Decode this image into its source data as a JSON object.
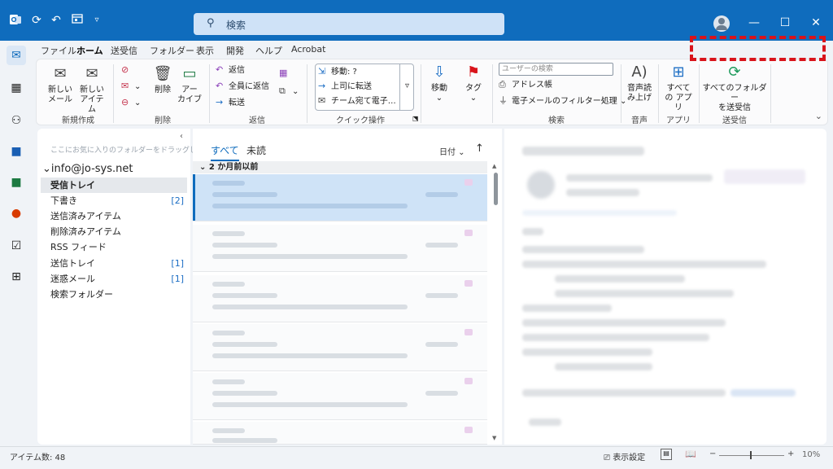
{
  "titlebar": {
    "search_placeholder": "検索",
    "icons": [
      "outlook-logo-icon",
      "sync-icon",
      "undo-icon",
      "calendar-view-icon",
      "customize-caret-icon"
    ]
  },
  "menu": [
    "ファイル",
    "ホーム",
    "送受信",
    "フォルダー",
    "表示",
    "開発",
    "ヘルプ",
    "Acrobat"
  ],
  "ribbon": {
    "new_mail": "新しい\nメール",
    "new_item": "新しい\nアイテム",
    "group_new": "新規作成",
    "delete": "削除",
    "archive": "アー\nカイブ",
    "group_delete": "削除",
    "reply": "返信",
    "reply_all": "全員に返信",
    "forward": "転送",
    "group_reply": "返信",
    "qs_move": "移動: ?",
    "qs_manager": "上司に転送",
    "qs_team": "チーム宛て電子…",
    "group_quick": "クイック操作",
    "move": "移動",
    "tags": "タグ",
    "user_search_placeholder": "ユーザーの検索",
    "address_book": "アドレス帳",
    "filter_mail": "電子メールのフィルター処理",
    "group_search": "検索",
    "read_aloud": "音声読\nみ上げ",
    "group_voice": "音声",
    "all_apps": "すべて\nの アプリ",
    "group_apps": "アプリ",
    "send_receive_all": "すべてのフォルダー\nを送受信",
    "group_send_receive": "送受信"
  },
  "folders": {
    "fav_hint": "ここにお気に入りのフォルダーをドラッグします",
    "account": "info@jo-sys.net",
    "items": [
      {
        "label": "受信トレイ",
        "count": ""
      },
      {
        "label": "下書き",
        "count": "[2]"
      },
      {
        "label": "送信済みアイテム",
        "count": ""
      },
      {
        "label": "削除済みアイテム",
        "count": ""
      },
      {
        "label": "RSS フィード",
        "count": ""
      },
      {
        "label": "送信トレイ",
        "count": "[1]"
      },
      {
        "label": "迷惑メール",
        "count": "[1]"
      },
      {
        "label": "検索フォルダー",
        "count": ""
      }
    ]
  },
  "messages": {
    "tab_all": "すべて",
    "tab_unread": "未読",
    "sort_by": "日付",
    "group_header": "2 か月前以前"
  },
  "status": {
    "items": "アイテム数: 48",
    "display_settings": "表示設定",
    "zoom": "10%"
  },
  "colors": {
    "accent": "#0f6cbd",
    "highlight_box": "#d9141b"
  }
}
